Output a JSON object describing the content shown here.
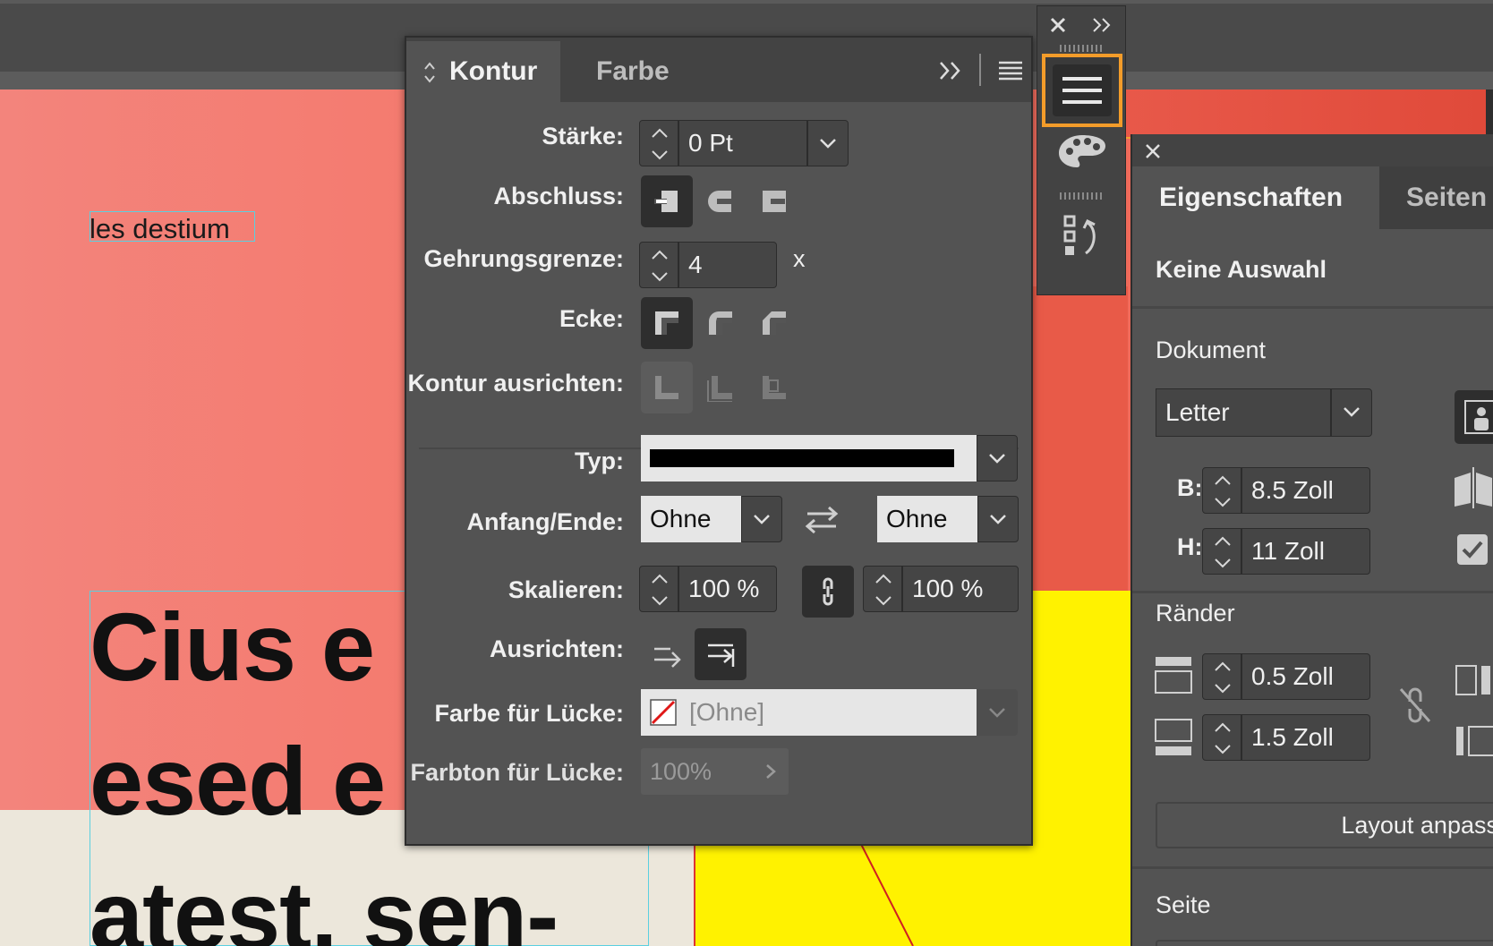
{
  "document": {
    "small_text": "les destium",
    "big_lines": [
      "Cius e",
      "esed e",
      "atest, sen-"
    ]
  },
  "kontur_panel": {
    "tabs": [
      {
        "label": "Kontur"
      },
      {
        "label": "Farbe"
      }
    ],
    "staerke": {
      "label": "Stärke:",
      "value": "0 Pt"
    },
    "abschluss": {
      "label": "Abschluss:"
    },
    "gehrungsgrenze": {
      "label": "Gehrungsgrenze:",
      "value": "4",
      "suffix": "x"
    },
    "ecke": {
      "label": "Ecke:"
    },
    "kontur_ausrichten": {
      "label": "Kontur ausrichten:"
    },
    "typ": {
      "label": "Typ:"
    },
    "anfang_ende": {
      "label": "Anfang/Ende:",
      "start": "Ohne",
      "end": "Ohne"
    },
    "skalieren": {
      "label": "Skalieren:",
      "start": "100 %",
      "end": "100 %"
    },
    "ausrichten": {
      "label": "Ausrichten:"
    },
    "farbe_luecke": {
      "label": "Farbe für Lücke:",
      "value": "[Ohne]"
    },
    "farbton_luecke": {
      "label": "Farbton für Lücke:",
      "value": "100%"
    }
  },
  "properties_panel": {
    "tabs": [
      {
        "label": "Eigenschaften"
      },
      {
        "label": "Seiten"
      }
    ],
    "selection": "Keine Auswahl",
    "dokument": {
      "heading": "Dokument",
      "preset": "Letter",
      "b_label": "B:",
      "b_value": "8.5 Zoll",
      "h_label": "H:",
      "h_value": "11 Zoll"
    },
    "raender": {
      "heading": "Ränder",
      "top": "0.5 Zoll",
      "bottom": "1.5 Zoll"
    },
    "layout_button": "Layout anpasse",
    "seite_heading": "Seite"
  },
  "colors": {
    "accent_orange": "#f39c2a",
    "panel_bg": "#535353",
    "page_salmon": "#f47a6e",
    "page_yellow": "#fff200"
  }
}
